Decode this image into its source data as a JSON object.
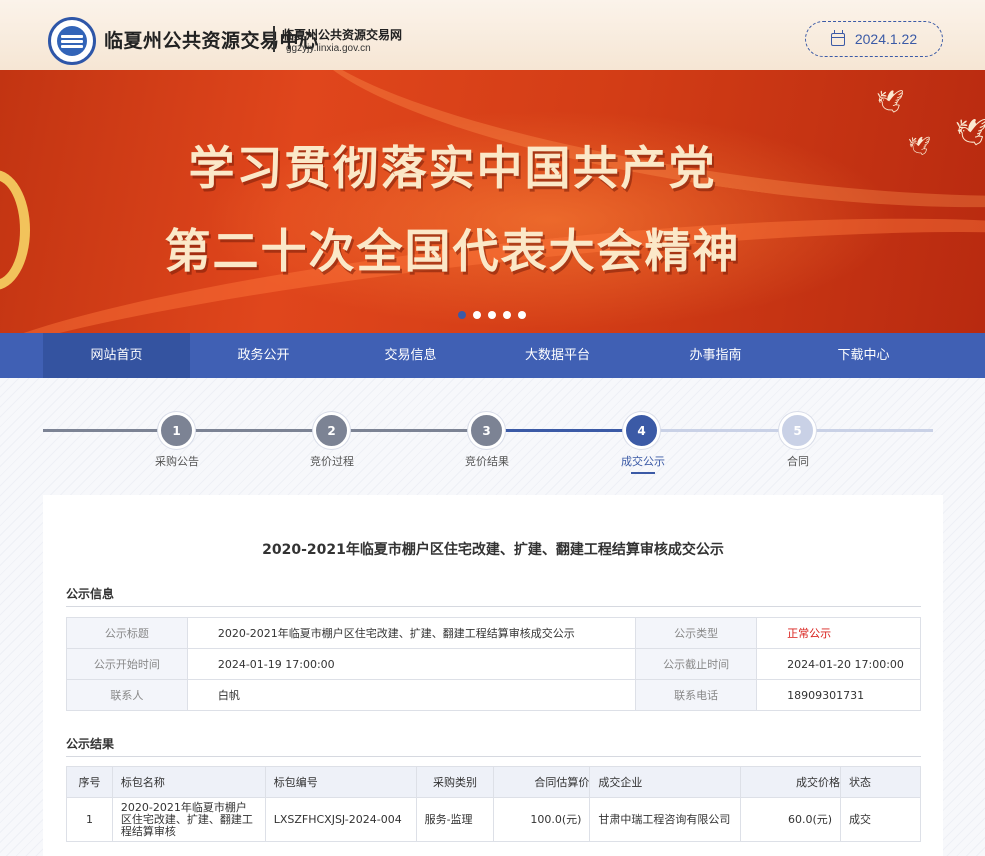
{
  "header": {
    "site_title": "临夏州公共资源交易中心",
    "site_subtitle": "临夏州公共资源交易网",
    "site_url": "ggzyjy.linxia.gov.cn",
    "date": "2024.1.22"
  },
  "banner": {
    "line1": "学习贯彻落实中国共产党",
    "line2": "第二十次全国代表大会精神",
    "slide_count": 5,
    "active_slide": 1
  },
  "nav": {
    "items": [
      "网站首页",
      "政务公开",
      "交易信息",
      "大数据平台",
      "办事指南",
      "下载中心"
    ],
    "active_index": 0
  },
  "steps": {
    "items": [
      {
        "num": "1",
        "label": "采购公告"
      },
      {
        "num": "2",
        "label": "竞价过程"
      },
      {
        "num": "3",
        "label": "竞价结果"
      },
      {
        "num": "4",
        "label": "成交公示"
      },
      {
        "num": "5",
        "label": "合同"
      }
    ],
    "current_index": 3
  },
  "page_title": "2020-2021年临夏市棚户区住宅改建、扩建、翻建工程结算审核成交公示",
  "notice_info": {
    "section_title": "公示信息",
    "rows": [
      {
        "l1": "公示标题",
        "v1": "2020-2021年临夏市棚户区住宅改建、扩建、翻建工程结算审核成交公示",
        "l2": "公示类型",
        "v2": "正常公示"
      },
      {
        "l1": "公示开始时间",
        "v1": "2024-01-19 17:00:00",
        "l2": "公示截止时间",
        "v2": "2024-01-20 17:00:00"
      },
      {
        "l1": "联系人",
        "v1": "白帆",
        "l2": "联系电话",
        "v2": "18909301731"
      }
    ]
  },
  "result": {
    "section_title": "公示结果",
    "headers": [
      "序号",
      "标包名称",
      "标包编号",
      "采购类别",
      "合同估算价",
      "成交企业",
      "成交价格",
      "状态"
    ],
    "rows": [
      {
        "index": "1",
        "name": "2020-2021年临夏市棚户区住宅改建、扩建、翻建工程结算审核",
        "code": "LXSZFHCXJSJ-2024-004",
        "category": "服务-监理",
        "estimate": "100.0(元)",
        "company": "甘肃中瑞工程咨询有限公司",
        "price": "60.0(元)",
        "status": "成交"
      }
    ]
  },
  "colors": {
    "primary": "#4060b4",
    "step_done": "#7c8394",
    "step_current": "#3b5aa6",
    "step_pending": "#c9d1e6",
    "highlight_red": "#d9201c"
  }
}
